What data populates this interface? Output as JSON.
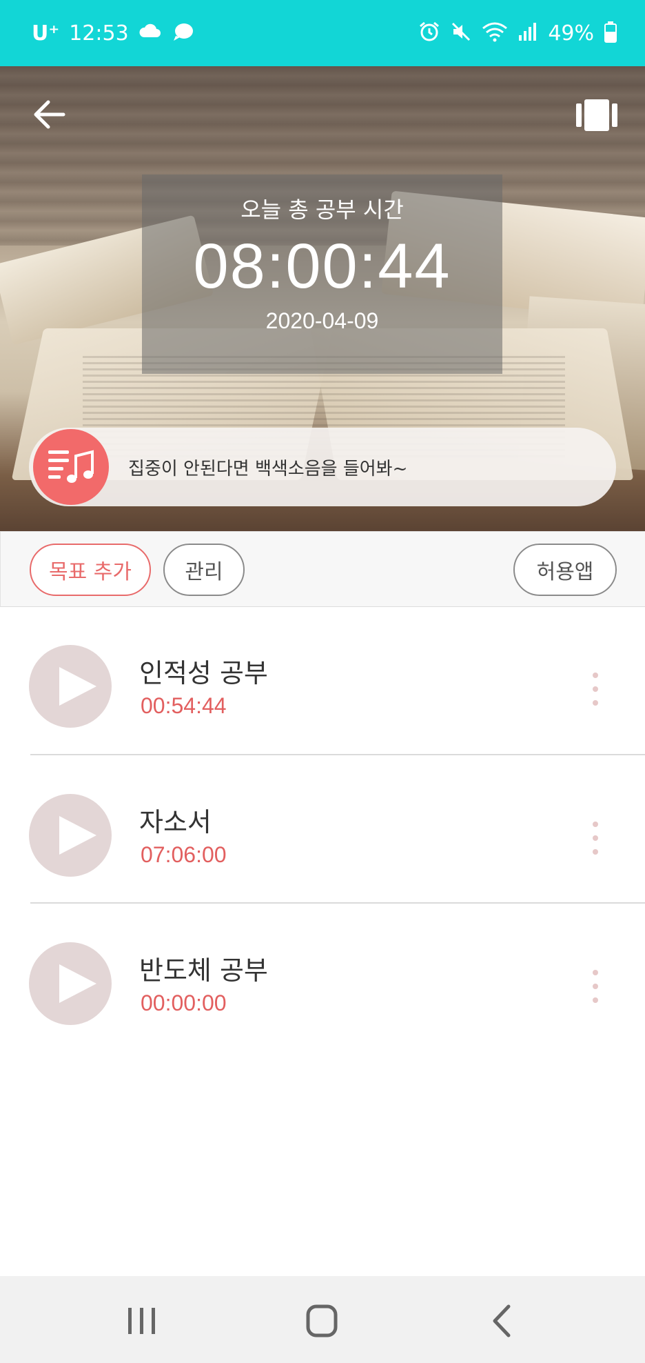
{
  "status_bar": {
    "carrier": "U⁺",
    "time": "12:53",
    "battery": "49%",
    "icons": [
      "cloud-icon",
      "chat-icon",
      "alarm-icon",
      "mute-icon",
      "wifi-icon",
      "signal-icon",
      "battery-icon"
    ]
  },
  "header": {
    "back_icon": "back-arrow-icon",
    "right_icon": "card-switch-icon"
  },
  "timer": {
    "title": "오늘 총 공부 시간",
    "value": "08:00:44",
    "date": "2020-04-09"
  },
  "noise_banner": {
    "icon": "music-list-icon",
    "text": "집중이 안된다면 백색소음을 들어봐~"
  },
  "actions": {
    "add_goal": "목표 추가",
    "manage": "관리",
    "allowed_apps": "허용앱"
  },
  "tasks": [
    {
      "name": "인적성 공부",
      "time": "00:54:44"
    },
    {
      "name": "자소서",
      "time": "07:06:00"
    },
    {
      "name": "반도체 공부",
      "time": "00:00:00"
    }
  ],
  "colors": {
    "status_bar": "#12d6d6",
    "accent": "#e86a6a",
    "play_bg": "#e3d6d6"
  },
  "nav": [
    "recent-apps-icon",
    "home-icon",
    "back-icon"
  ]
}
